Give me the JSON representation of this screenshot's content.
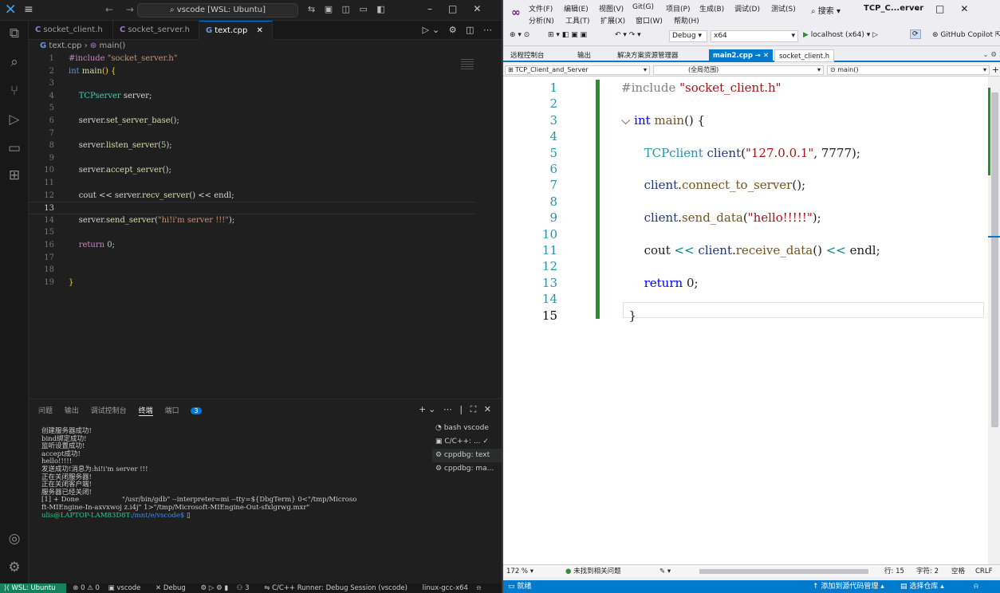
{
  "vscode": {
    "search": "vscode [WSL: Ubuntu]",
    "tabs": [
      "socket_client.h",
      "socket_server.h",
      "text.cpp"
    ],
    "breadcrumb": {
      "file": "text.cpp",
      "symbol": "main()"
    },
    "code_lines": [
      {
        "n": "1",
        "html": "<span class=\"pp\">#include</span> <span class=\"str\">\"socket_server.h\"</span>"
      },
      {
        "n": "2",
        "html": "<span class=\"kw\">int</span> <span class=\"fn\">main</span><span class=\"br\">()</span> <span class=\"br\">{</span>"
      },
      {
        "n": "3",
        "html": ""
      },
      {
        "n": "4",
        "html": "    <span class=\"ty\">TCPserver</span> <span class=\"pl\">server;</span>"
      },
      {
        "n": "5",
        "html": ""
      },
      {
        "n": "6",
        "html": "    <span class=\"pl\">server.</span><span class=\"fn\">set_server_base</span><span class=\"pl\">();</span>"
      },
      {
        "n": "7",
        "html": ""
      },
      {
        "n": "8",
        "html": "    <span class=\"pl\">server.</span><span class=\"fn\">listen_server</span><span class=\"pl\">(</span><span class=\"num\">5</span><span class=\"pl\">);</span>"
      },
      {
        "n": "9",
        "html": ""
      },
      {
        "n": "10",
        "html": "    <span class=\"pl\">server.</span><span class=\"fn\">accept_server</span><span class=\"pl\">();</span>"
      },
      {
        "n": "11",
        "html": ""
      },
      {
        "n": "12",
        "html": "    <span class=\"pl\">cout &lt;&lt; server.</span><span class=\"fn\">recv_server</span><span class=\"pl\">() &lt;&lt; endl;</span>"
      },
      {
        "n": "13",
        "html": "",
        "cur": true
      },
      {
        "n": "14",
        "html": "    <span class=\"pl\">server.</span><span class=\"fn\">send_server</span><span class=\"pl\">(</span><span class=\"str\">\"hi!i'm server !!!\"</span><span class=\"pl\">);</span>"
      },
      {
        "n": "15",
        "html": ""
      },
      {
        "n": "16",
        "html": "    <span class=\"pp\">return</span> <span class=\"num\">0</span><span class=\"pl\">;</span>"
      },
      {
        "n": "17",
        "html": ""
      },
      {
        "n": "18",
        "html": ""
      },
      {
        "n": "19",
        "html": "<span class=\"br\">}</span>"
      }
    ],
    "panel_tabs": [
      "问题",
      "输出",
      "调试控制台",
      "终端",
      "端口"
    ],
    "ports_badge": "3",
    "terminal_lines": [
      "创建服务器成功!",
      "bind绑定成功!",
      "监听设置成功!",
      "accept成功!",
      "hello!!!!!",
      "发送成功!消息为:hi!i'm server !!!",
      "正在关闭服务器!",
      "正在关闭客户端!",
      "服务器已经关闭!",
      "[1] + Done                    \"/usr/bin/gdb\" --interpreter=mi --tty=${DbgTerm} 0<\"/tmp/Microso",
      "ft-MIEngine-In-axvxwoj z.i4j\" 1>\"/tmp/Microsoft-MIEngine-Out-sfxlgrwg.mxr\""
    ],
    "prompt_user": "ulis@LAPTOP-LAM83D8T",
    "prompt_path": ":/mnt/e/vscode$ ",
    "terminal_list": [
      "bash vscode",
      "C/C++: ... ✓",
      "cppdbg: text",
      "cppdbg: ma..."
    ],
    "status": {
      "wsl": "WSL: Ubuntu",
      "problems": "⊗ 0 ⚠ 0",
      "folder": "vscode",
      "debug": "Debug",
      "workers": "3",
      "runner": "C/C++ Runner: Debug Session (vscode)",
      "config": "linux-gcc-x64"
    }
  },
  "vs": {
    "menu_row1": [
      "文件(F)",
      "编辑(E)",
      "视图(V)",
      "Git(G)",
      "项目(P)",
      "生成(B)",
      "调试(D)",
      "测试(S)"
    ],
    "menu_row2": [
      "分析(N)",
      "工具(T)",
      "扩展(X)",
      "窗口(W)",
      "帮助(H)"
    ],
    "search": "搜索",
    "solution": "TCP_C...erver",
    "config": "Debug",
    "platform": "x64",
    "run_target": "localhost (x64)",
    "copilot": "GitHub Copilot",
    "doc_tabs": [
      "远程控制台",
      "输出",
      "解决方案资源管理器",
      "main2.cpp",
      "socket_client.h"
    ],
    "nav_project": "TCP_Client_and_Server",
    "nav_scope": "(全局范围)",
    "nav_member": "main()",
    "code_lines": [
      {
        "n": "1",
        "html": "<span class=\"spp\">#include</span> <span class=\"sstr\">\"socket_client.h\"</span>"
      },
      {
        "n": "2",
        "html": ""
      },
      {
        "n": "3",
        "html": "<span style=\"color:#333\">⌵</span> <span class=\"skw\">int</span> <span class=\"sfn\">main</span>() {"
      },
      {
        "n": "4",
        "html": ""
      },
      {
        "n": "5",
        "html": "      <span class=\"sty\">TCPclient</span> <span class=\"sid\">client</span>(<span class=\"sstr\">\"127.0.0.1\"</span>, 7777);"
      },
      {
        "n": "6",
        "html": ""
      },
      {
        "n": "7",
        "html": "      <span class=\"sid\">client</span>.<span class=\"sfn\">connect_to_server</span>();"
      },
      {
        "n": "8",
        "html": ""
      },
      {
        "n": "9",
        "html": "      <span class=\"sid\">client</span>.<span class=\"sfn\">send_data</span>(<span class=\"sstr\">\"hello!!!!!\"</span>);"
      },
      {
        "n": "10",
        "html": ""
      },
      {
        "n": "11",
        "html": "      cout <span class=\"sop\">&lt;&lt;</span> <span class=\"sid\">client</span>.<span class=\"sfn\">receive_data</span>() <span class=\"sop\">&lt;&lt;</span> endl;"
      },
      {
        "n": "12",
        "html": ""
      },
      {
        "n": "13",
        "html": "      <span class=\"skw\">return</span> 0;"
      },
      {
        "n": "14",
        "html": ""
      },
      {
        "n": "15",
        "html": "  }",
        "cur": true
      }
    ],
    "zoom": "172 %",
    "issues": "未找到相关问题",
    "position": {
      "line": "行: 15",
      "col": "字符: 2",
      "ws": "空格",
      "eol": "CRLF"
    },
    "status_ready": "就绪",
    "status_add_source": "↑ 添加到源代码管理 ▴",
    "status_repo": "选择仓库 ▴"
  }
}
